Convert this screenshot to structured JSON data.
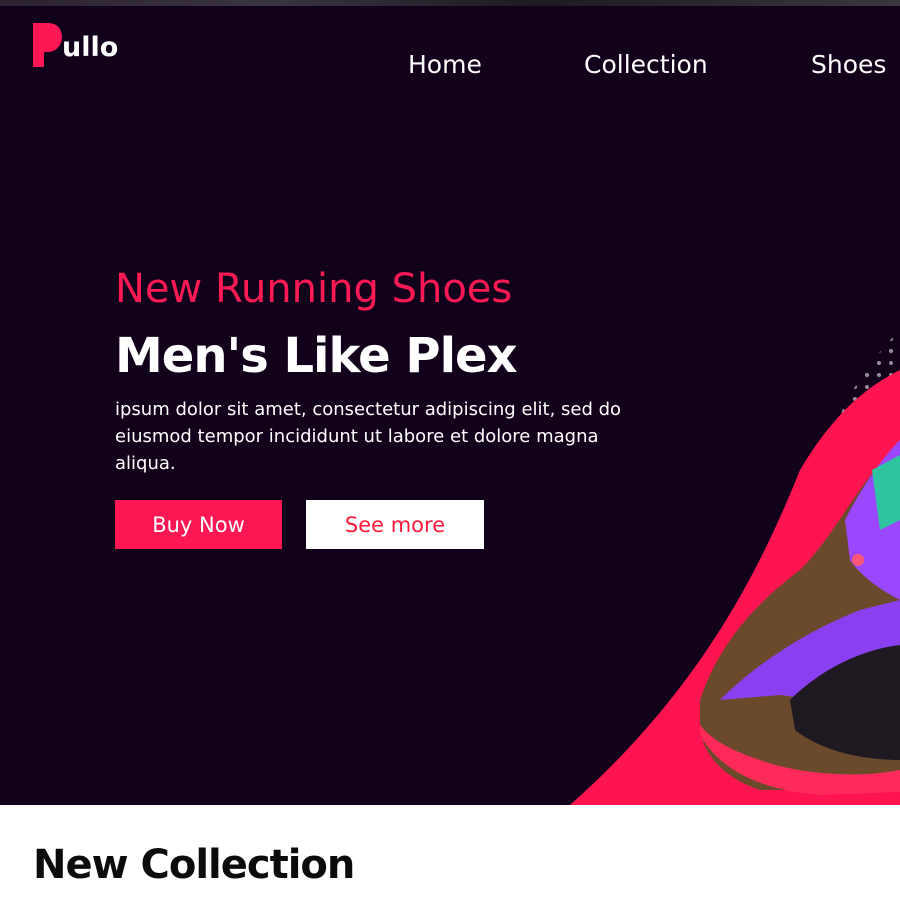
{
  "brand": {
    "name": "ullo",
    "initial": "P",
    "accent_color": "#ff1755",
    "hero_background": "#12011a"
  },
  "nav": {
    "items": [
      {
        "label": "Home"
      },
      {
        "label": "Collection"
      },
      {
        "label": "Shoes"
      }
    ]
  },
  "hero": {
    "eyebrow": "New Running Shoes",
    "headline": "Men's Like Plex",
    "description": "ipsum dolor sit amet, consectetur adipiscing elit, sed do eiusmod tempor incididunt ut labore et dolore magna aliqua.",
    "buy_label": "Buy Now",
    "see_more_label": "See more",
    "image": "running-shoe-image"
  },
  "collection": {
    "title": "New Collection"
  }
}
